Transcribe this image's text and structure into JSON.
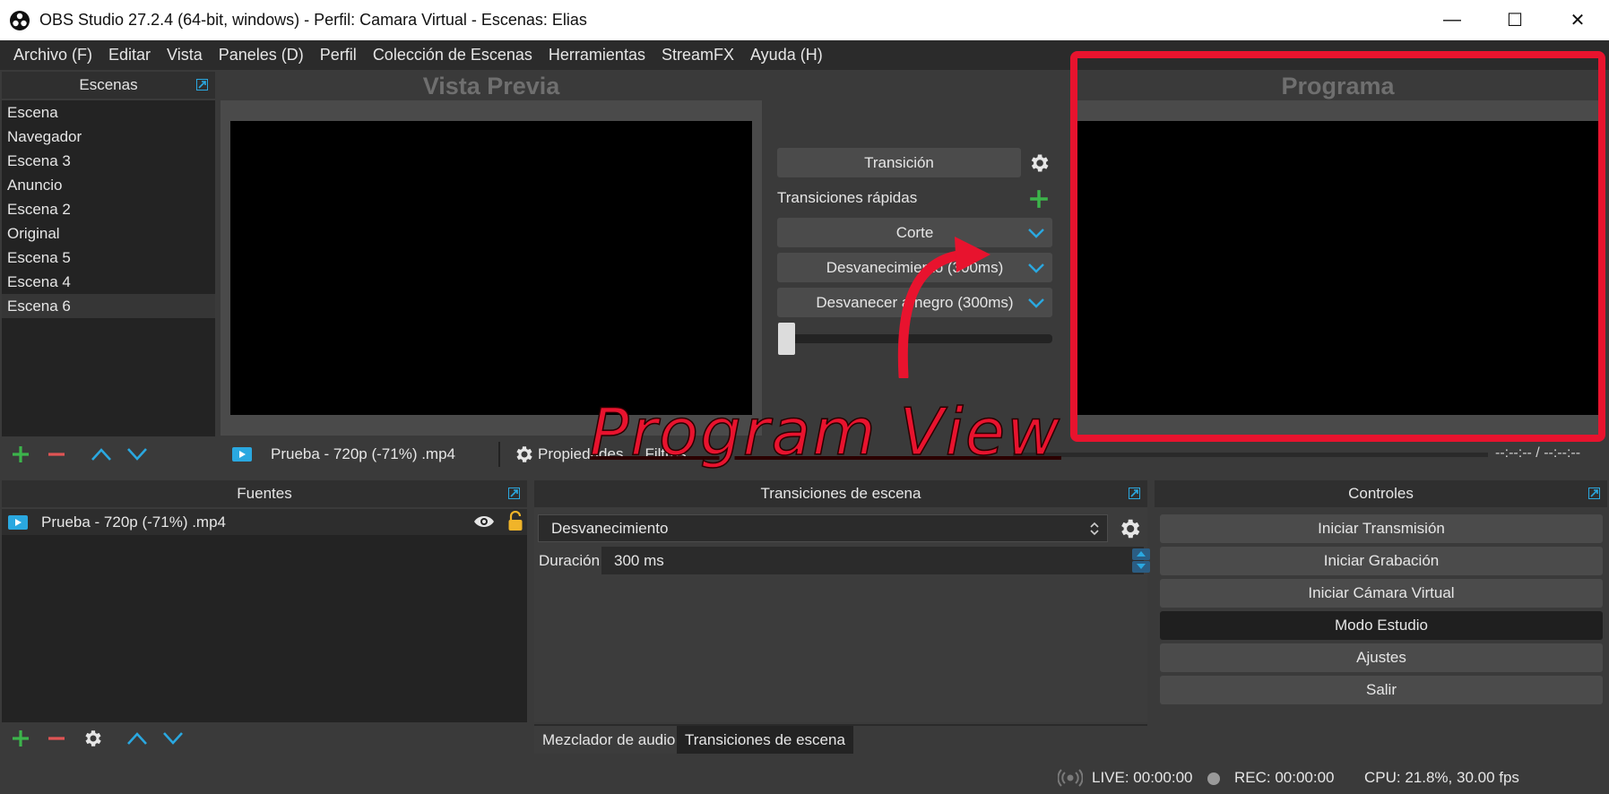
{
  "window": {
    "title": "OBS Studio 27.2.4 (64-bit, windows) - Perfil: Camara Virtual - Escenas: Elias",
    "minimize": "—",
    "maximize": "☐",
    "close": "✕"
  },
  "menu": [
    "Archivo (F)",
    "Editar",
    "Vista",
    "Paneles (D)",
    "Perfil",
    "Colección de Escenas",
    "Herramientas",
    "StreamFX",
    "Ayuda (H)"
  ],
  "scenes": {
    "title": "Escenas",
    "items": [
      "Escena",
      "Navegador",
      "Escena 3",
      "Anuncio",
      "Escena 2",
      "Original",
      "Escena 5",
      "Escena 4",
      "Escena 6"
    ],
    "selected_index": 8
  },
  "preview": {
    "label": "Vista Previa"
  },
  "program": {
    "label": "Programa"
  },
  "transition_panel": {
    "transition_button": "Transición",
    "quick_label": "Transiciones rápidas",
    "quick_items": [
      "Corte",
      "Desvanecimiento (300ms)",
      "Desvanecer a negro (300ms)"
    ],
    "tbar_value": 0
  },
  "source_bar": {
    "source_name": "Prueba - 720p (-71%) .mp4",
    "properties_label": "Propiedades",
    "filters_label": "Filtros",
    "time": "--:--:-- / --:--:--"
  },
  "annotation": {
    "text": "Program View",
    "color": "#e8132e"
  },
  "sources": {
    "title": "Fuentes",
    "items": [
      {
        "name": "Prueba - 720p (-71%) .mp4",
        "visible": true,
        "locked": false
      }
    ]
  },
  "scene_transitions": {
    "title": "Transiciones de escena",
    "selected": "Desvanecimiento",
    "duration_label": "Duración",
    "duration_value": "300 ms",
    "tabs": [
      "Mezclador de audio",
      "Transiciones de escena"
    ],
    "active_tab": 1
  },
  "controls": {
    "title": "Controles",
    "buttons": [
      "Iniciar Transmisión",
      "Iniciar Grabación",
      "Iniciar Cámara Virtual",
      "Modo Estudio",
      "Ajustes",
      "Salir"
    ],
    "active_index": 3
  },
  "status": {
    "live": "LIVE: 00:00:00",
    "rec": "REC: 00:00:00",
    "cpu": "CPU: 21.8%, 30.00 fps"
  },
  "colors": {
    "accent_blue": "#2aa8e0",
    "add_green": "#3cb44b",
    "remove_red": "#e05555",
    "highlight_red": "#e8132e"
  }
}
